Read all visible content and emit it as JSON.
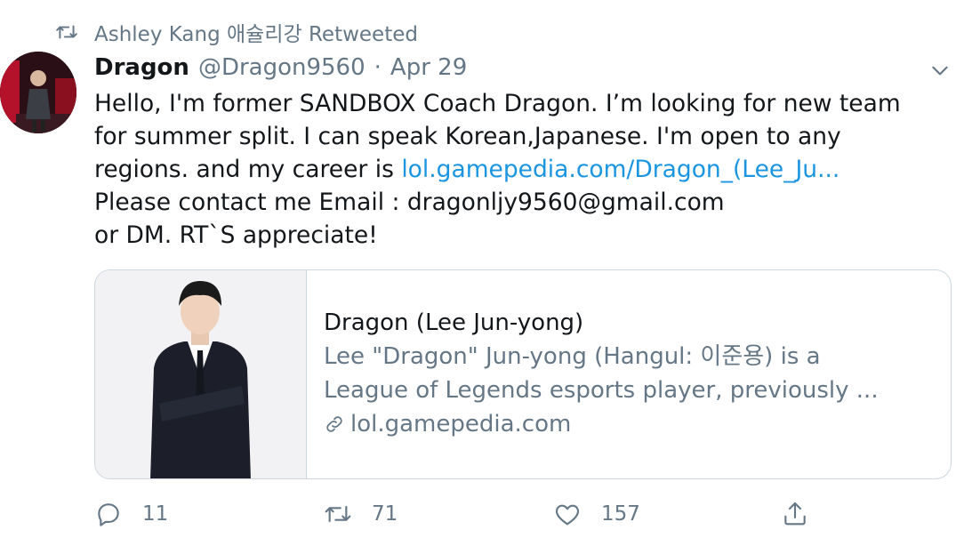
{
  "retweet_banner": {
    "text": "Ashley Kang 애슐리강 Retweeted"
  },
  "tweet": {
    "display_name": "Dragon",
    "handle": "@Dragon9560",
    "separator": "·",
    "date": "Apr 29",
    "lines": [
      "Hello, I'm former SANDBOX Coach Dragon.  I’m looking for new team",
      "for summer split. I can speak Korean,Japanese. I'm open to any",
      "regions. and my career is "
    ],
    "link_text": "lol.gamepedia.com/Dragon_(Lee_Ju...",
    "lines_after": [
      "Please contact me Email : dragonljy9560@gmail.com",
      "or DM.  RT`S appreciate!"
    ]
  },
  "card": {
    "title": "Dragon (Lee Jun-yong)",
    "desc_line1": "Lee \"Dragon\" Jun-yong (Hangul: 이준용) is a",
    "desc_line2": "League of Legends esports player, previously ...",
    "domain": "lol.gamepedia.com"
  },
  "actions": {
    "reply_count": "11",
    "retweet_count": "71",
    "like_count": "157"
  },
  "icons": [
    "retweet-icon",
    "chevron-down-icon",
    "reply-icon",
    "like-icon",
    "share-icon",
    "link-icon"
  ],
  "colors": {
    "link": "#1b95e0",
    "secondary": "#657786",
    "border": "#ccd6dd"
  }
}
